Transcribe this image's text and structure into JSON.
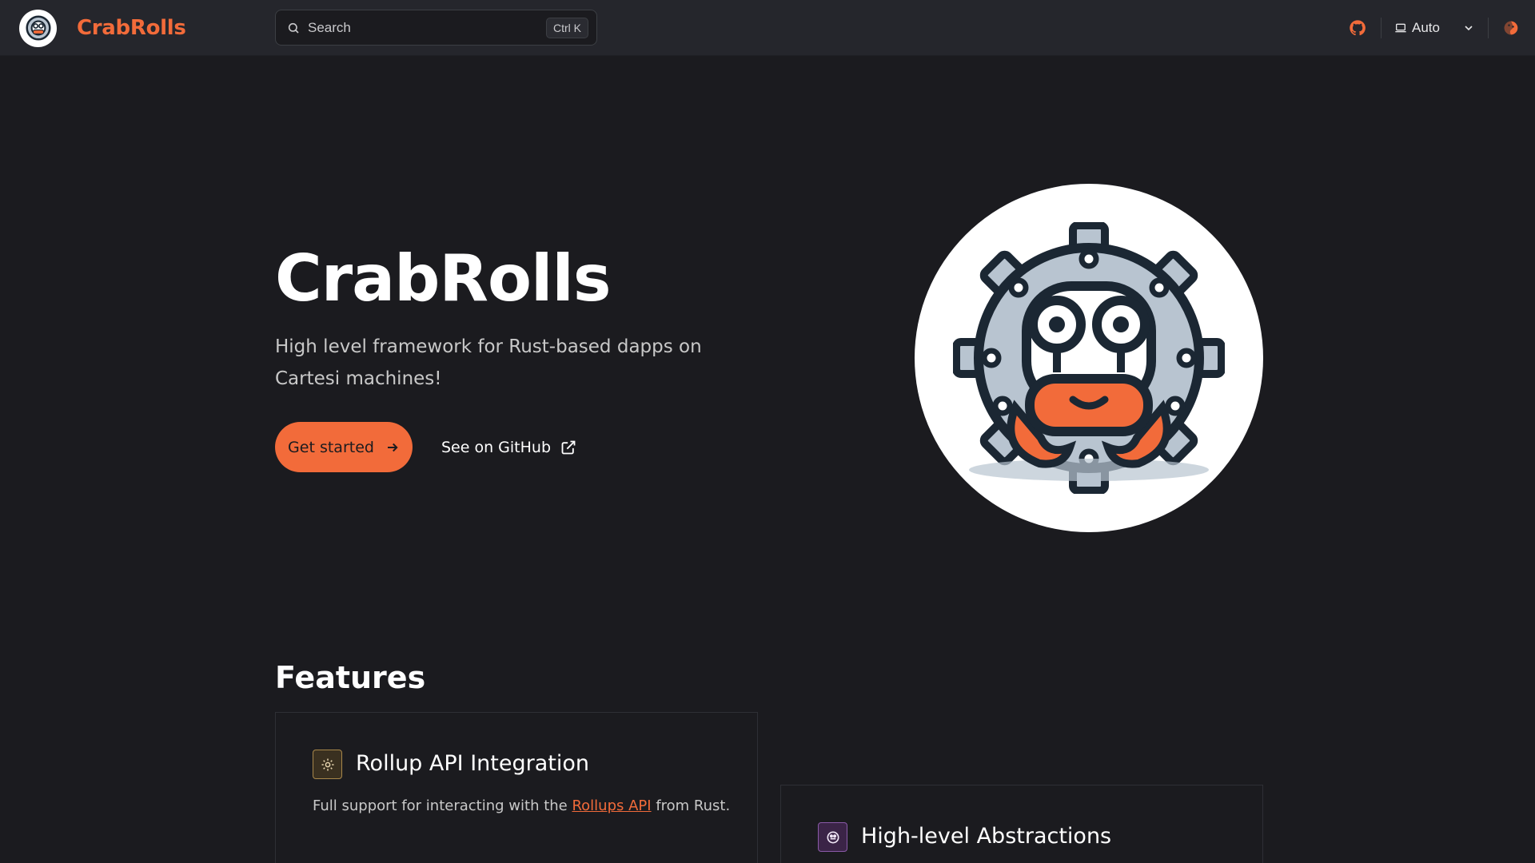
{
  "nav": {
    "brand": "CrabRolls",
    "search_label": "Search",
    "search_shortcut": "Ctrl K",
    "appearance_mode": "Auto"
  },
  "hero": {
    "title": "CrabRolls",
    "tagline": "High level framework for Rust-based dapps on Cartesi machines!",
    "primary_button": "Get started",
    "secondary_button": "See on GitHub"
  },
  "features": {
    "heading": "Features",
    "items": [
      {
        "title": "Rollup API Integration",
        "desc_before": "Full support for interacting with the ",
        "desc_link": "Rollups API",
        "desc_after": " from Rust.",
        "icon": "gear-icon"
      },
      {
        "title": "High-level Abstractions",
        "icon": "crab-icon"
      }
    ]
  },
  "colors": {
    "accent": "#f26b3a",
    "background": "#1b1b1f",
    "nav_background": "#25262c"
  }
}
